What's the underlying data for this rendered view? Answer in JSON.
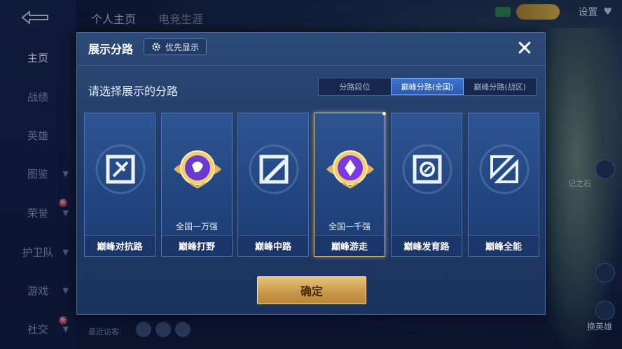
{
  "background": {
    "sidebar": {
      "items": [
        {
          "label": "主页",
          "active": true,
          "chevron": false,
          "badge": false
        },
        {
          "label": "战绩",
          "active": false,
          "chevron": false,
          "badge": false
        },
        {
          "label": "英雄",
          "active": false,
          "chevron": false,
          "badge": false
        },
        {
          "label": "图鉴",
          "active": false,
          "chevron": true,
          "badge": false
        },
        {
          "label": "荣誉",
          "active": false,
          "chevron": true,
          "badge": true
        },
        {
          "label": "护卫队",
          "active": false,
          "chevron": true,
          "badge": false
        },
        {
          "label": "游戏",
          "active": false,
          "chevron": true,
          "badge": false
        },
        {
          "label": "社交",
          "active": false,
          "chevron": true,
          "badge": true
        }
      ],
      "badge_text": "新"
    },
    "top_tabs": [
      "个人主页",
      "电竞生涯"
    ],
    "settings_label": "设置",
    "stone_label": "记之石",
    "switch_label": "换英雄",
    "recent_label": "最近访客:"
  },
  "modal": {
    "title": "展示分路",
    "priority_label": "优先显示",
    "subtitle": "请选择展示的分路",
    "tabs": [
      {
        "label": "分路段位",
        "active": false
      },
      {
        "label": "巅峰分路(全国)",
        "active": true
      },
      {
        "label": "巅峰分路(战区)",
        "active": false
      }
    ],
    "cards": [
      {
        "name": "巅峰对抗路",
        "rank": "",
        "icon": "clash-lane-icon",
        "selected": false
      },
      {
        "name": "巅峰打野",
        "rank": "全国一万强",
        "icon": "jungle-medal-icon",
        "selected": false
      },
      {
        "name": "巅峰中路",
        "rank": "",
        "icon": "mid-lane-icon",
        "selected": false
      },
      {
        "name": "巅峰游走",
        "rank": "全国一千强",
        "icon": "roam-medal-icon",
        "selected": true
      },
      {
        "name": "巅峰发育路",
        "rank": "",
        "icon": "farm-lane-icon",
        "selected": false
      },
      {
        "name": "巅峰全能",
        "rank": "",
        "icon": "all-round-icon",
        "selected": false
      }
    ],
    "confirm_label": "确定"
  },
  "colors": {
    "modal_bg": "#213a66",
    "gold": "#e8c47a",
    "active_tab": "#3c74cc",
    "purple": "#6a3ad0"
  }
}
